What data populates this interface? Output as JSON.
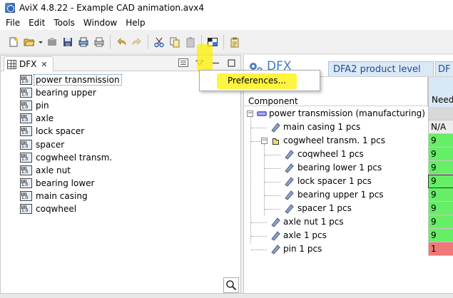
{
  "window": {
    "title": "AviX 4.8.22 - Example CAD animation.avx4"
  },
  "menubar": {
    "items": [
      "File",
      "Edit",
      "Tools",
      "Window",
      "Help"
    ]
  },
  "toolbar": {
    "icons": [
      "new-icon",
      "open-icon",
      "disabled-icon",
      "save-icon",
      "print-preview-icon",
      "print-icon",
      "undo-icon",
      "redo-icon",
      "cut-icon",
      "copy-icon",
      "paste-icon",
      "window-icon",
      "clipboard-icon"
    ]
  },
  "left_panel": {
    "tab_label": "DFX",
    "items": [
      {
        "label": "power transmission",
        "selected": true
      },
      {
        "label": "bearing upper"
      },
      {
        "label": "pin"
      },
      {
        "label": "axle"
      },
      {
        "label": "lock spacer"
      },
      {
        "label": "spacer"
      },
      {
        "label": "cogwheel transm."
      },
      {
        "label": "axle nut"
      },
      {
        "label": "bearing lower"
      },
      {
        "label": "main casing"
      },
      {
        "label": "coqwheel"
      }
    ]
  },
  "popup_menu": {
    "items": [
      "Preferences..."
    ]
  },
  "right_panel": {
    "title": "DFX",
    "tabs": [
      "DFA2 product level",
      "DF"
    ],
    "columns": {
      "component": "Component",
      "need": "Need"
    },
    "rows": [
      {
        "label": "power transmission (manufacturing)",
        "value": "",
        "status": "grey"
      },
      {
        "label": "main casing 1 pcs",
        "value": "N/A",
        "status": "na"
      },
      {
        "label": "cogwheel transm. 1 pcs",
        "value": "9",
        "status": "green"
      },
      {
        "label": "coqwheel 1 pcs",
        "value": "9",
        "status": "green"
      },
      {
        "label": "bearing lower 1 pcs",
        "value": "9",
        "status": "green"
      },
      {
        "label": "lock spacer 1 pcs",
        "value": "9",
        "status": "green"
      },
      {
        "label": "bearing upper 1 pcs",
        "value": "9",
        "status": "green"
      },
      {
        "label": "spacer 1 pcs",
        "value": "9",
        "status": "green"
      },
      {
        "label": "axle nut 1 pcs",
        "value": "9",
        "status": "green"
      },
      {
        "label": "axle 1 pcs",
        "value": "9",
        "status": "green"
      },
      {
        "label": "pin 1 pcs",
        "value": "1",
        "status": "red"
      }
    ]
  },
  "colors": {
    "accent": "#3b7dc6",
    "green": "#66ee66",
    "red": "#f07878",
    "highlight": "#fff000"
  }
}
